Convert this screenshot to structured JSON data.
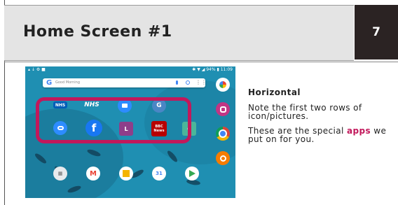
{
  "slide": {
    "title": "Home Screen #1",
    "page_number": "7"
  },
  "tablet": {
    "status_left": "▴ ↓ ⚙ ■",
    "status_right": "✱ ▼ ◢ 94% ▮ 11:09",
    "search_placeholder": "Good Morning",
    "highlight_color": "#c2185b",
    "apps_row1": [
      "NHS",
      "NHS",
      "Zoom",
      "Google Translate"
    ],
    "apps_row2": [
      "Zoom",
      "Facebook",
      "L",
      "BBC News",
      "C"
    ]
  },
  "text": {
    "heading": "Horizontal",
    "para1": "Note  the first two rows of icon/pictures.",
    "para2_before": "These are the special ",
    "para2_highlight": "apps",
    "para2_after": " we put on for you."
  }
}
